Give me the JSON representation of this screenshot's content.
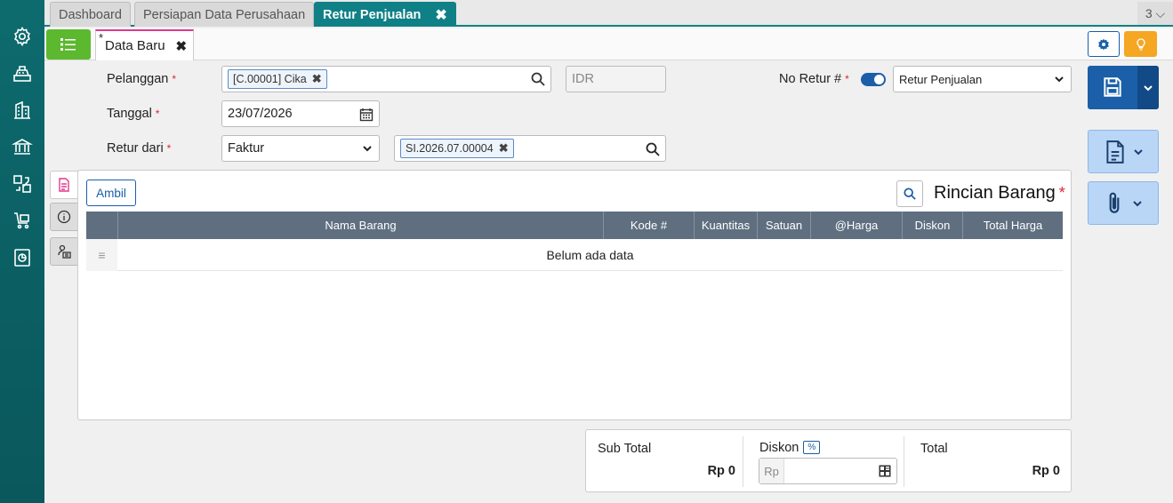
{
  "top_tabs": [
    {
      "label": "Dashboard"
    },
    {
      "label": "Persiapan Data Perusahaan"
    },
    {
      "label": "Retur Penjualan",
      "close": "✖"
    }
  ],
  "page_count": "3 ⌵",
  "sub_tab": {
    "modified_mark": "*",
    "label": "Data Baru",
    "close": "✖"
  },
  "form": {
    "pelanggan_label": "Pelanggan",
    "pelanggan_chip": "[C.00001] Cika",
    "currency": "IDR",
    "tanggal_label": "Tanggal",
    "tanggal_value": "23/07/2026",
    "retur_dari_label": "Retur dari",
    "retur_dari_value": "Faktur",
    "faktur_chip": "SI.2026.07.00004",
    "no_retur_label": "No Retur #",
    "no_retur_type": "Retur Penjualan",
    "required_mark": "*",
    "chip_remove": "✖"
  },
  "panel": {
    "ambil_label": "Ambil",
    "title": "Rincian Barang",
    "columns": [
      "Nama Barang",
      "Kode #",
      "Kuantitas",
      "Satuan",
      "@Harga",
      "Diskon",
      "Total Harga"
    ],
    "empty_text": "Belum ada data",
    "drag_handle": "≡"
  },
  "totals": {
    "subtotal_label": "Sub Total",
    "subtotal_value": "Rp 0",
    "diskon_label": "Diskon",
    "diskon_pct": "%",
    "diskon_prefix": "Rp",
    "total_label": "Total",
    "total_value": "Rp 0"
  },
  "colors": {
    "sidebar": "#0d6b6e",
    "active_tab": "#0f8086",
    "primary": "#1a5fa8",
    "list_button": "#5cb82e",
    "bulb_button": "#f5a623",
    "required": "#d9263a"
  }
}
